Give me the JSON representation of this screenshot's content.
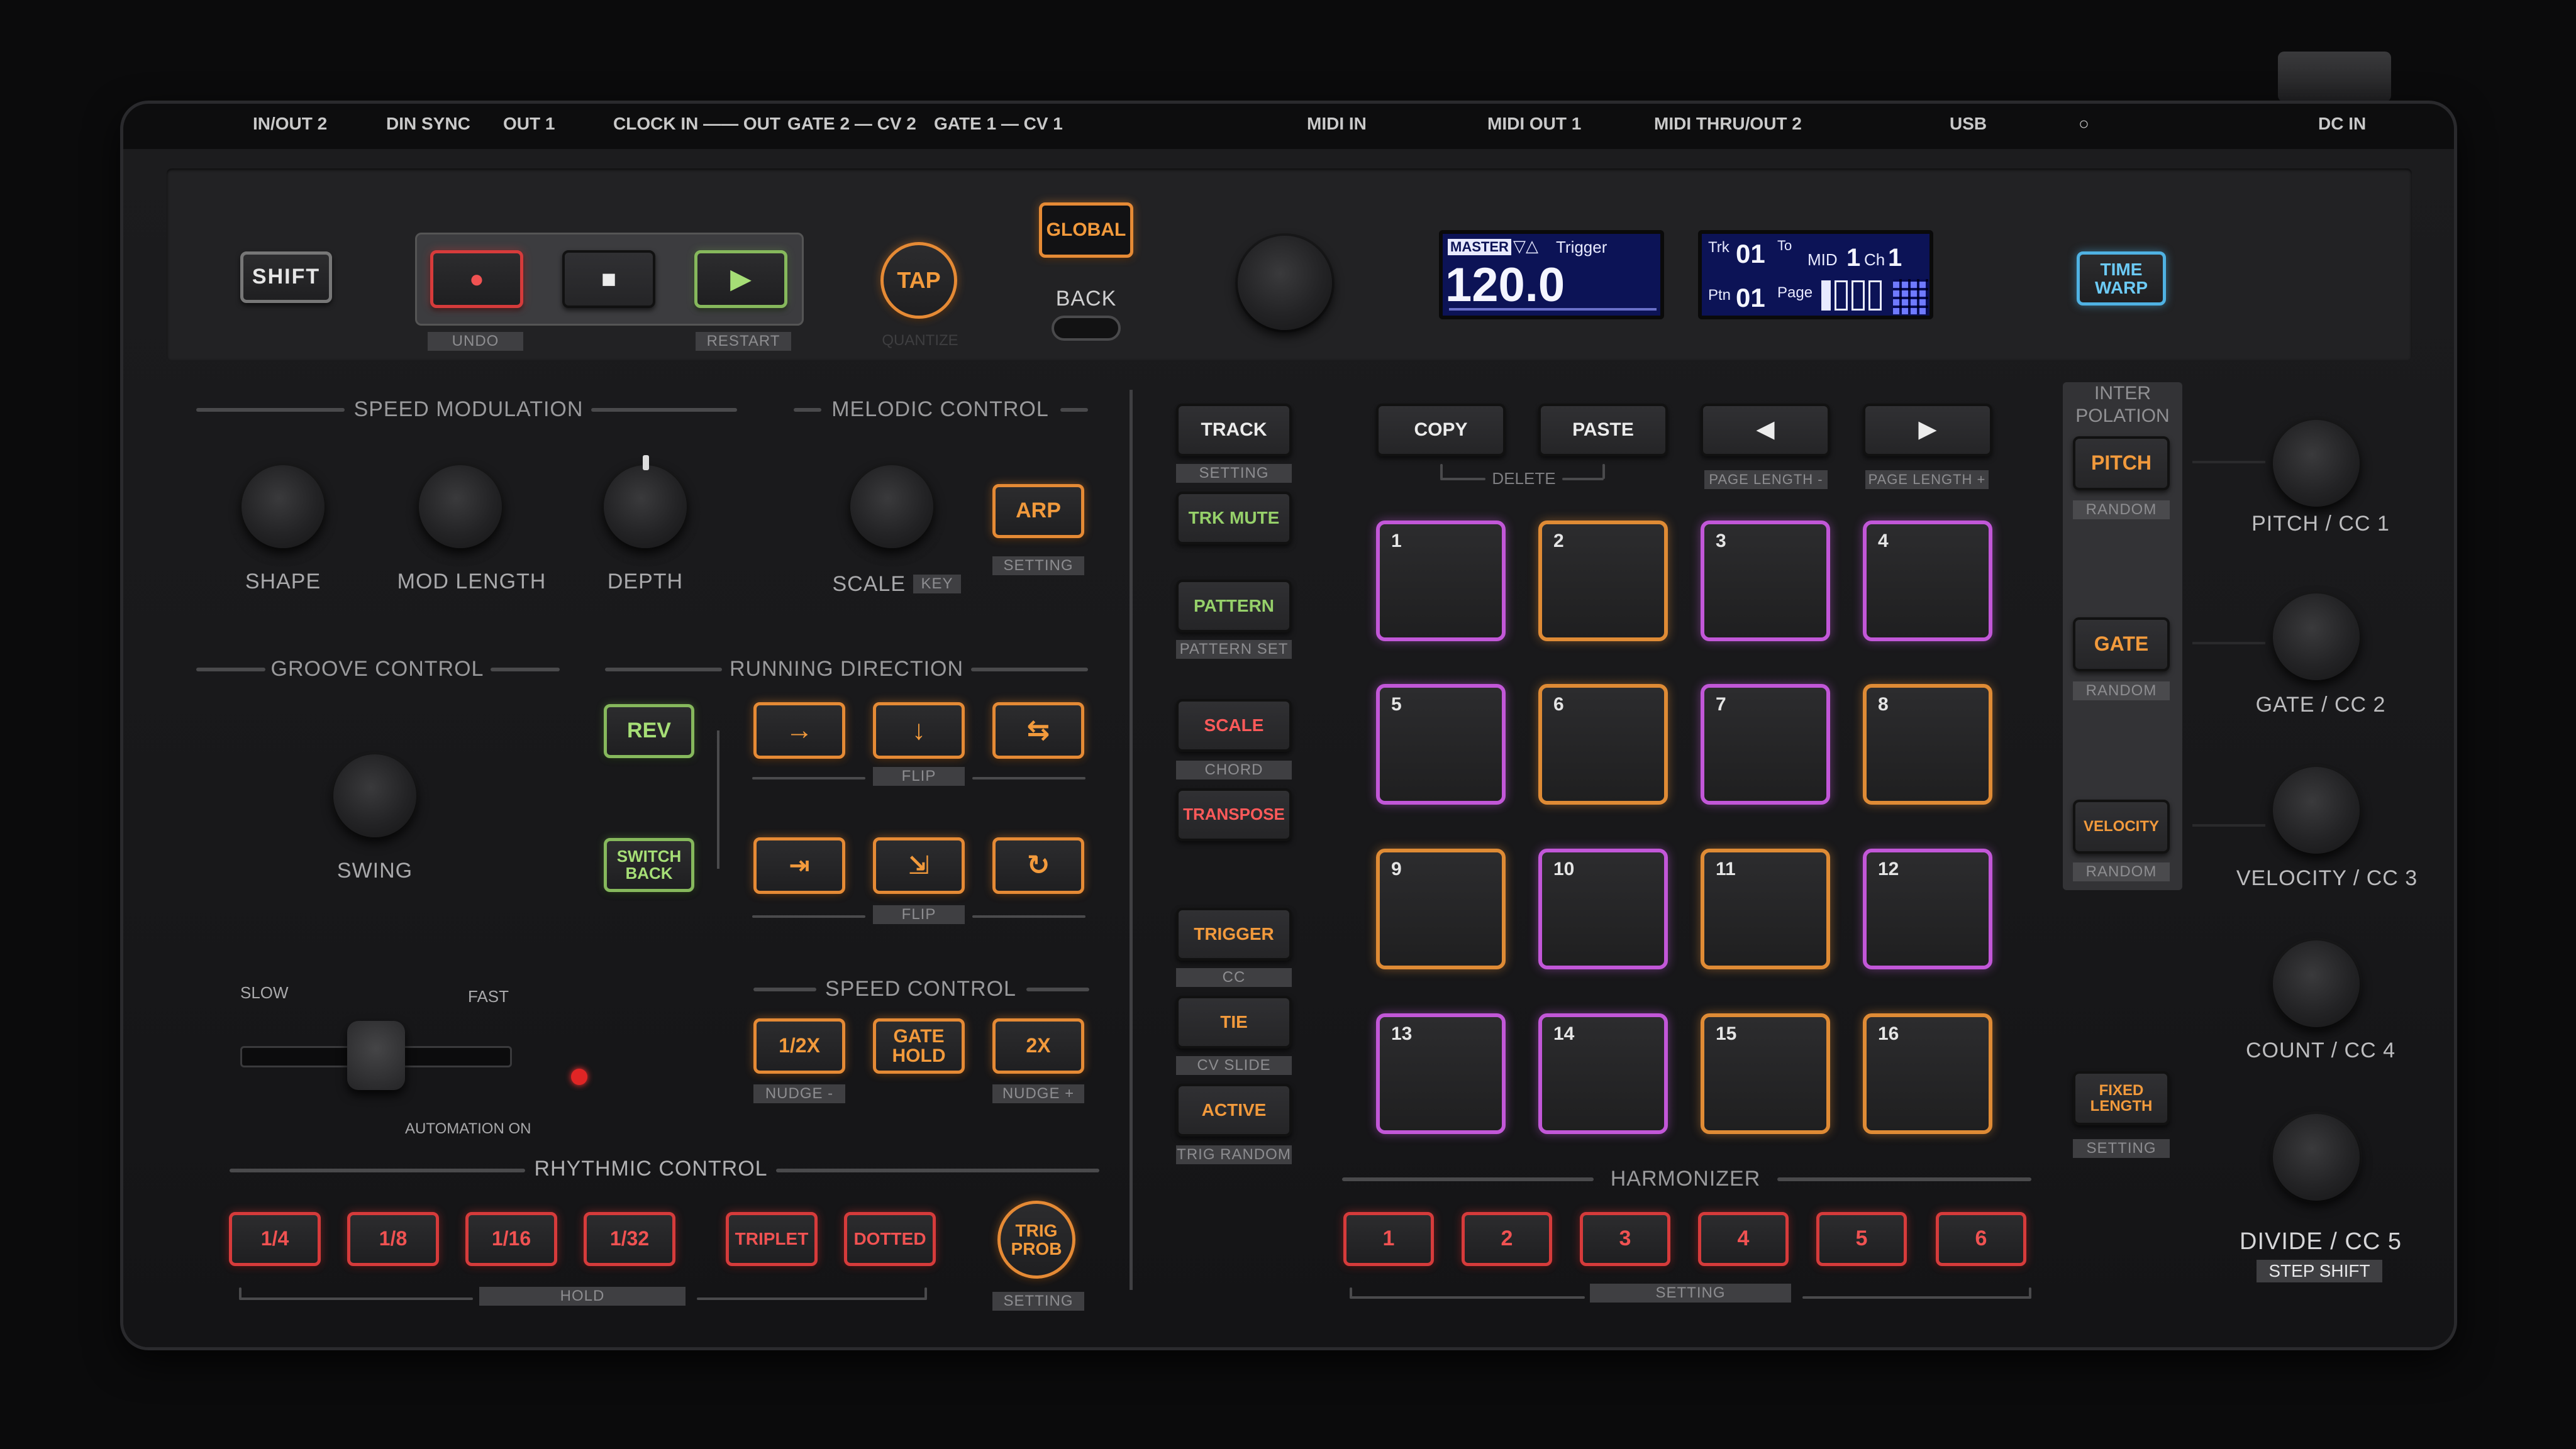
{
  "ports": [
    "IN/OUT 2",
    "DIN SYNC",
    "OUT 1",
    "CLOCK  IN —— OUT",
    "GATE  2 — CV 2",
    "GATE 1 — CV 1",
    "MIDI IN",
    "MIDI OUT 1",
    "MIDI THRU/OUT 2",
    "USB",
    "○",
    "DC IN"
  ],
  "transport": {
    "shift": "SHIFT",
    "record": "●",
    "stop": "■",
    "play": "▶",
    "undo": "UNDO",
    "restart": "RESTART",
    "tap": "TAP",
    "quantize": "QUANTIZE",
    "global": "GLOBAL",
    "back": "BACK",
    "time_warp": "TIME\nWARP"
  },
  "display1": {
    "master": "MASTER",
    "icons": "▽△",
    "mode": "Trigger",
    "tempo": "120.0"
  },
  "display2": {
    "trk_label": "Trk",
    "trk": "01",
    "to": "To",
    "midi": "MID",
    "midi_num": "1",
    "ch_label": "Ch",
    "ch": "1",
    "ptn_label": "Ptn",
    "ptn": "01",
    "page_label": "Page"
  },
  "speed_modulation": {
    "title": "SPEED MODULATION",
    "knobs": [
      "SHAPE",
      "MOD LENGTH",
      "DEPTH"
    ]
  },
  "melodic": {
    "title": "MELODIC CONTROL",
    "scale": "SCALE",
    "key": "KEY",
    "arp": "ARP",
    "setting": "SETTING"
  },
  "groove": {
    "title": "GROOVE CONTROL",
    "swing": "SWING",
    "slow": "SLOW",
    "fast": "FAST",
    "automation": "AUTOMATION ON"
  },
  "running": {
    "title": "RUNNING DIRECTION",
    "rev": "REV",
    "switch_back": "SWITCH\nBACK",
    "flip": "FLIP"
  },
  "speed_control": {
    "title": "SPEED CONTROL",
    "half": "1/2X",
    "gate_hold": "GATE\nHOLD",
    "double": "2X",
    "nudge_minus": "NUDGE -",
    "nudge_plus": "NUDGE +"
  },
  "rhythmic": {
    "title": "RHYTHMIC  CONTROL",
    "buttons": [
      "1/4",
      "1/8",
      "1/16",
      "1/32",
      "TRIPLET",
      "DOTTED"
    ],
    "hold": "HOLD",
    "trig_prob": "TRIG\nPROB",
    "setting": "SETTING"
  },
  "track_col": {
    "track": "TRACK",
    "track_sub": "SETTING",
    "trk_mute": "TRK MUTE",
    "pattern": "PATTERN",
    "pattern_sub": "PATTERN SET",
    "scale": "SCALE",
    "scale_sub": "CHORD",
    "transpose": "TRANSPOSE",
    "trigger": "TRIGGER",
    "trigger_sub": "CC",
    "tie": "TIE",
    "tie_sub": "CV SLIDE",
    "active": "ACTIVE",
    "active_sub": "TRIG RANDOM"
  },
  "edit": {
    "copy": "COPY",
    "paste": "PASTE",
    "delete": "DELETE",
    "prev": "◀",
    "next": "▶",
    "page_minus": "PAGE LENGTH -",
    "page_plus": "PAGE LENGTH +"
  },
  "pads": [
    "1",
    "2",
    "3",
    "4",
    "5",
    "6",
    "7",
    "8",
    "9",
    "10",
    "11",
    "12",
    "13",
    "14",
    "15",
    "16"
  ],
  "pad_colors": [
    "purple",
    "orange",
    "purple",
    "purple",
    "purple",
    "orange",
    "purple",
    "orange",
    "orange",
    "purple",
    "orange",
    "purple",
    "purple",
    "purple",
    "orange",
    "orange"
  ],
  "harmonizer": {
    "title": "HARMONIZER",
    "buttons": [
      "1",
      "2",
      "3",
      "4",
      "5",
      "6"
    ],
    "setting": "SETTING"
  },
  "interpolation": {
    "title": "INTER\nPOLATION",
    "pitch": "PITCH",
    "gate": "GATE",
    "velocity": "VELOCITY",
    "random": "RANDOM",
    "fixed_length": "FIXED\nLENGTH",
    "setting": "SETTING"
  },
  "right_knobs": [
    "PITCH / CC 1",
    "GATE / CC 2",
    "VELOCITY / CC 3",
    "COUNT / CC 4",
    "DIVIDE / CC 5"
  ],
  "step_shift": "STEP SHIFT"
}
